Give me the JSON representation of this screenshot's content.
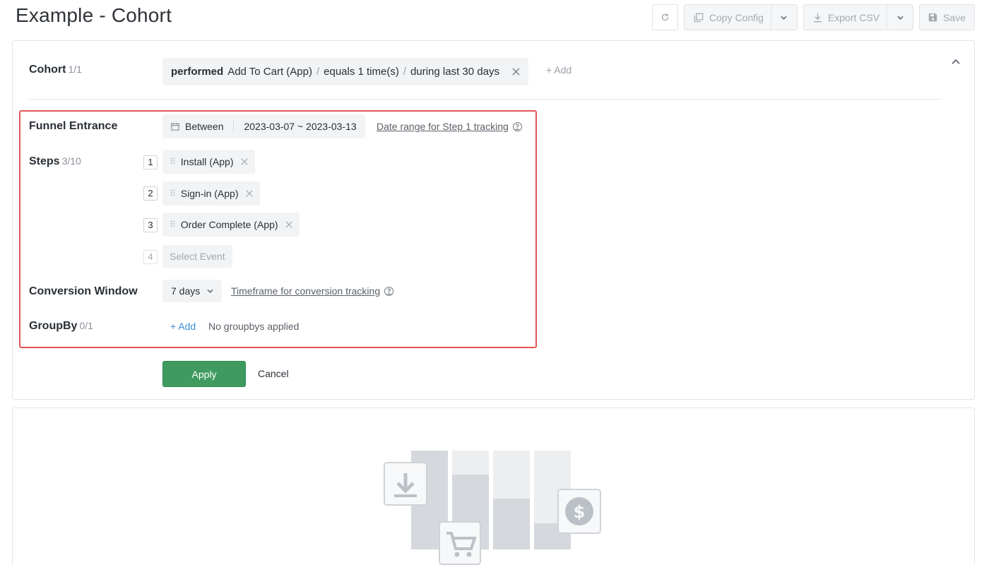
{
  "header": {
    "title": "Example - Cohort",
    "toolbar": {
      "copy_config_label": "Copy Config",
      "export_csv_label": "Export CSV",
      "save_label": "Save"
    }
  },
  "cohort": {
    "label": "Cohort",
    "count": "1/1",
    "filter": {
      "verb": "performed",
      "event": "Add To Cart (App)",
      "separator": "/",
      "condition": "equals 1 time(s)",
      "period": "during last 30 days"
    },
    "add_label": "+ Add"
  },
  "funnel_entrance": {
    "label": "Funnel Entrance",
    "mode": "Between",
    "date_range": "2023-03-07 ~ 2023-03-13",
    "help_link": "Date range for Step 1 tracking"
  },
  "steps": {
    "label": "Steps",
    "count": "3/10",
    "items": [
      {
        "number": "1",
        "event": "Install (App)"
      },
      {
        "number": "2",
        "event": "Sign-in (App)"
      },
      {
        "number": "3",
        "event": "Order Complete (App)"
      }
    ],
    "next": {
      "number": "4",
      "placeholder": "Select Event"
    }
  },
  "conversion_window": {
    "label": "Conversion Window",
    "value": "7 days",
    "help_link": "Timeframe for conversion tracking"
  },
  "groupby": {
    "label": "GroupBy",
    "count": "0/1",
    "add_label": "+ Add",
    "empty_text": "No groupbys applied"
  },
  "actions": {
    "apply_label": "Apply",
    "cancel_label": "Cancel"
  },
  "colors": {
    "highlight": "#e25555",
    "apply": "#3e9a5f",
    "link_blue": "#3d8fd6"
  }
}
